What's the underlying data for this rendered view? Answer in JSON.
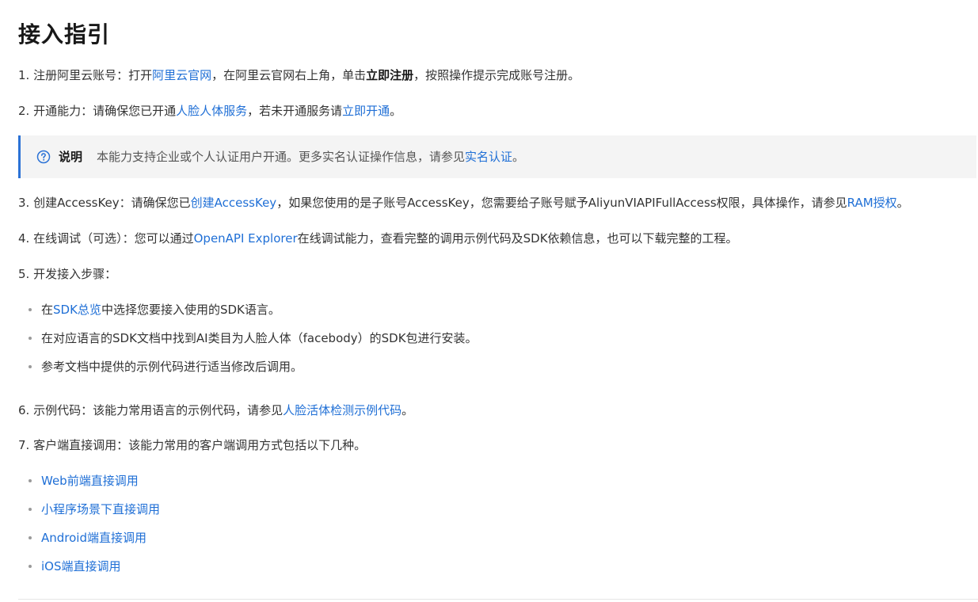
{
  "title": "接入指引",
  "steps": {
    "s1": {
      "num": "1.",
      "a": "注册阿里云账号：打开",
      "link1": "阿里云官网",
      "b": "，在阿里云官网右上角，单击",
      "strong": "立即注册",
      "c": "，按照操作提示完成账号注册。"
    },
    "s2": {
      "num": "2.",
      "a": "开通能力：请确保您已开通",
      "link1": "人脸人体服务",
      "b": "，若未开通服务请",
      "link2": "立即开通",
      "c": "。"
    },
    "note": {
      "title": "说明",
      "text": "本能力支持企业或个人认证用户开通。更多实名认证操作信息，请参见",
      "link": "实名认证",
      "end": "。"
    },
    "s3": {
      "num": "3.",
      "a": "创建AccessKey：请确保您已",
      "link1": "创建AccessKey",
      "b": "，如果您使用的是子账号AccessKey，您需要给子账号赋予AliyunVIAPIFullAccess权限，具体操作，请参见",
      "link2": "RAM授权",
      "c": "。"
    },
    "s4": {
      "num": "4.",
      "a": "在线调试（可选）：您可以通过",
      "link1": "OpenAPI Explorer",
      "b": "在线调试能力，查看完整的调用示例代码及SDK依赖信息，也可以下载完整的工程。"
    },
    "s5": {
      "num": "5.",
      "a": "开发接入步骤：",
      "bullets": [
        {
          "pre": "在",
          "link": "SDK总览",
          "post": "中选择您要接入使用的SDK语言。"
        },
        {
          "pre": "在对应语言的SDK文档中找到AI类目为人脸人体（facebody）的SDK包进行安装。",
          "link": "",
          "post": ""
        },
        {
          "pre": "参考文档中提供的示例代码进行适当修改后调用。",
          "link": "",
          "post": ""
        }
      ]
    },
    "s6": {
      "num": "6.",
      "a": "示例代码：该能力常用语言的示例代码，请参见",
      "link1": "人脸活体检测示例代码",
      "c": "。"
    },
    "s7": {
      "num": "7.",
      "a": "客户端直接调用：该能力常用的客户端调用方式包括以下几种。",
      "links": [
        "Web前端直接调用",
        "小程序场景下直接调用",
        "Android端直接调用",
        "iOS端直接调用"
      ]
    }
  },
  "colors": {
    "link": "#1f6fd6",
    "note_border": "#2b72d6",
    "note_bg": "#f4f4f4"
  },
  "icons": {
    "note": "question-circle-icon"
  }
}
